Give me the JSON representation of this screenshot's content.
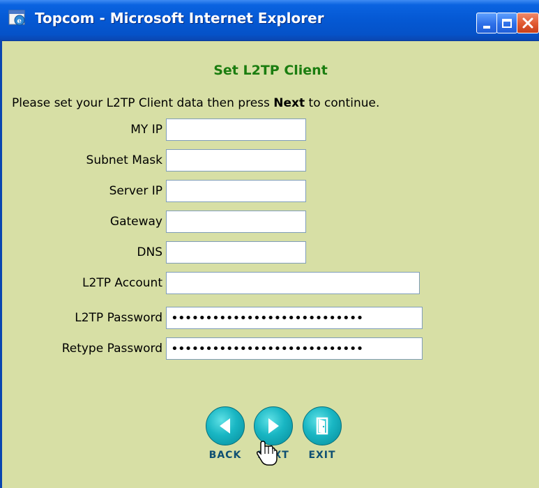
{
  "window": {
    "title": "Topcom - Microsoft Internet Explorer",
    "controls": {
      "minimize_icon": "minimize-icon",
      "maximize_icon": "maximize-icon",
      "close_icon": "close-icon"
    }
  },
  "page": {
    "title": "Set L2TP Client",
    "instructions": {
      "before": "Please set your L2TP Client data then press ",
      "emphasis": "Next",
      "after": " to continue."
    }
  },
  "form": {
    "fields": [
      {
        "label": "MY IP",
        "value": ""
      },
      {
        "label": "Subnet Mask",
        "value": ""
      },
      {
        "label": "Server IP",
        "value": ""
      },
      {
        "label": "Gateway",
        "value": ""
      },
      {
        "label": "DNS",
        "value": ""
      },
      {
        "label": "L2TP Account",
        "value": ""
      },
      {
        "label": "L2TP Password",
        "value": "••••••••••••••••••••••••••••"
      },
      {
        "label": "Retype Password",
        "value": "••••••••••••••••••••••••••••"
      }
    ]
  },
  "nav": {
    "back": {
      "label": "BACK",
      "icon": "arrow-left-icon"
    },
    "next": {
      "label": "NEXT",
      "icon": "arrow-right-icon"
    },
    "exit": {
      "label": "EXIT",
      "icon": "door-exit-icon"
    }
  },
  "colors": {
    "page_background": "#d7dfa5",
    "title_green": "#1b7d10",
    "titlebar_blue": "#0558d3",
    "button_teal": "#19b6c3",
    "button_label": "#0e4f72"
  }
}
